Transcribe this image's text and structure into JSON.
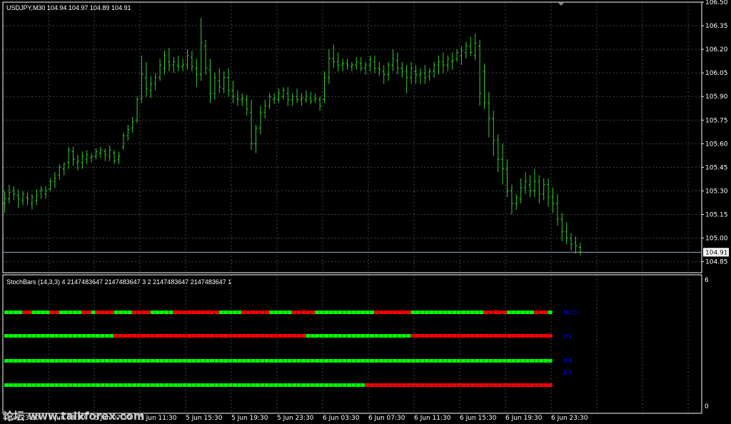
{
  "colors": {
    "background": "#000000",
    "grid": "#3a4a4a",
    "frame": "#ffffff",
    "bar": "#32cd32",
    "last_price_line": "#8eaec8",
    "stoch_up": "#00ff00",
    "stoch_down": "#ff0000",
    "tf_label": "#0000ff"
  },
  "chart_data": [
    {
      "type": "ohlc",
      "title": "USDJPY,M30  104.94 104.97 104.89 104.91",
      "symbol": "USDJPY,M30",
      "y_ticks": [
        "106.50",
        "106.35",
        "106.20",
        "106.05",
        "105.90",
        "105.75",
        "105.60",
        "105.45",
        "105.30",
        "105.15",
        "105.00",
        "104.85"
      ],
      "ylim": [
        104.78,
        106.5
      ],
      "last_price": "104.91",
      "x_ticks": [
        "4 Jun 23:30",
        "5 Jun 03:30",
        "5 Jun 07:30",
        "5 Jun 11:30",
        "5 Jun 15:30",
        "5 Jun 19:30",
        "5 Jun 23:30",
        "6 Jun 03:30",
        "6 Jun 07:30",
        "6 Jun 11:30",
        "6 Jun 15:30",
        "6 Jun 19:30",
        "6 Jun 23:30"
      ],
      "bars": [
        [
          105.22,
          105.3,
          105.16,
          105.25
        ],
        [
          105.25,
          105.34,
          105.22,
          105.29
        ],
        [
          105.3,
          105.33,
          105.24,
          105.28
        ],
        [
          105.27,
          105.31,
          105.19,
          105.25
        ],
        [
          105.24,
          105.3,
          105.21,
          105.28
        ],
        [
          105.26,
          105.29,
          105.21,
          105.25
        ],
        [
          105.22,
          105.28,
          105.18,
          105.26
        ],
        [
          105.24,
          105.31,
          105.21,
          105.27
        ],
        [
          105.3,
          105.33,
          105.25,
          105.31
        ],
        [
          105.28,
          105.33,
          105.25,
          105.3
        ],
        [
          105.31,
          105.38,
          105.3,
          105.36
        ],
        [
          105.36,
          105.42,
          105.32,
          105.38
        ],
        [
          105.4,
          105.47,
          105.37,
          105.45
        ],
        [
          105.44,
          105.48,
          105.4,
          105.47
        ],
        [
          105.48,
          105.58,
          105.44,
          105.56
        ],
        [
          105.55,
          105.58,
          105.46,
          105.5
        ],
        [
          105.48,
          105.53,
          105.43,
          105.49
        ],
        [
          105.48,
          105.55,
          105.44,
          105.52
        ],
        [
          105.5,
          105.56,
          105.47,
          105.53
        ],
        [
          105.51,
          105.54,
          105.48,
          105.52
        ],
        [
          105.52,
          105.57,
          105.5,
          105.55
        ],
        [
          105.54,
          105.58,
          105.51,
          105.56
        ],
        [
          105.55,
          105.57,
          105.49,
          105.53
        ],
        [
          105.52,
          105.59,
          105.49,
          105.56
        ],
        [
          105.54,
          105.56,
          105.47,
          105.49
        ],
        [
          105.5,
          105.55,
          105.47,
          105.52
        ],
        [
          105.58,
          105.67,
          105.56,
          105.65
        ],
        [
          105.65,
          105.72,
          105.62,
          105.69
        ],
        [
          105.7,
          105.77,
          105.67,
          105.74
        ],
        [
          105.75,
          105.9,
          105.73,
          105.88
        ],
        [
          105.89,
          106.16,
          105.86,
          106.04
        ],
        [
          106.02,
          106.12,
          105.9,
          105.95
        ],
        [
          105.94,
          106.03,
          105.89,
          105.98
        ],
        [
          105.98,
          106.05,
          105.94,
          106.02
        ],
        [
          106.02,
          106.14,
          106.0,
          106.1
        ],
        [
          106.08,
          106.19,
          106.04,
          106.16
        ],
        [
          106.12,
          106.21,
          106.06,
          106.1
        ],
        [
          106.1,
          106.15,
          106.05,
          106.12
        ],
        [
          106.1,
          106.16,
          106.06,
          106.09
        ],
        [
          106.09,
          106.14,
          106.06,
          106.1
        ],
        [
          106.1,
          106.2,
          106.07,
          106.16
        ],
        [
          106.15,
          106.19,
          106.06,
          106.09
        ],
        [
          106.08,
          106.14,
          105.96,
          106.04
        ],
        [
          106.04,
          106.4,
          106.0,
          106.24
        ],
        [
          106.22,
          106.26,
          106.04,
          106.08
        ],
        [
          106.07,
          106.14,
          105.86,
          105.92
        ],
        [
          105.92,
          106.05,
          105.88,
          106.02
        ],
        [
          106.0,
          106.08,
          105.92,
          105.96
        ],
        [
          105.95,
          106.06,
          105.92,
          106.02
        ],
        [
          106.02,
          106.08,
          105.9,
          105.94
        ],
        [
          105.94,
          106.0,
          105.86,
          105.9
        ],
        [
          105.89,
          105.94,
          105.84,
          105.88
        ],
        [
          105.88,
          105.92,
          105.84,
          105.89
        ],
        [
          105.88,
          105.91,
          105.78,
          105.82
        ],
        [
          105.8,
          105.88,
          105.56,
          105.6
        ],
        [
          105.6,
          105.72,
          105.54,
          105.7
        ],
        [
          105.7,
          105.84,
          105.66,
          105.8
        ],
        [
          105.8,
          105.88,
          105.76,
          105.84
        ],
        [
          105.84,
          105.92,
          105.82,
          105.9
        ],
        [
          105.88,
          105.92,
          105.85,
          105.89
        ],
        [
          105.88,
          105.95,
          105.86,
          105.92
        ],
        [
          105.9,
          105.96,
          105.88,
          105.94
        ],
        [
          105.92,
          105.96,
          105.84,
          105.88
        ],
        [
          105.88,
          105.92,
          105.84,
          105.9
        ],
        [
          105.9,
          105.95,
          105.86,
          105.88
        ],
        [
          105.88,
          105.92,
          105.84,
          105.89
        ],
        [
          105.88,
          105.94,
          105.86,
          105.9
        ],
        [
          105.89,
          105.93,
          105.85,
          105.87
        ],
        [
          105.88,
          105.92,
          105.86,
          105.89
        ],
        [
          105.88,
          105.9,
          105.81,
          105.84
        ],
        [
          105.88,
          106.06,
          105.86,
          106.02
        ],
        [
          106.02,
          106.2,
          105.98,
          106.14
        ],
        [
          106.14,
          106.23,
          106.08,
          106.12
        ],
        [
          106.12,
          106.18,
          106.06,
          106.1
        ],
        [
          106.1,
          106.14,
          106.06,
          106.11
        ],
        [
          106.11,
          106.14,
          106.07,
          106.1
        ],
        [
          106.09,
          106.12,
          106.06,
          106.1
        ],
        [
          106.1,
          106.15,
          106.07,
          106.12
        ],
        [
          106.11,
          106.15,
          106.06,
          106.08
        ],
        [
          106.08,
          106.12,
          106.04,
          106.1
        ],
        [
          106.1,
          106.16,
          106.06,
          106.14
        ],
        [
          106.12,
          106.16,
          106.05,
          106.08
        ],
        [
          106.08,
          106.12,
          106.03,
          106.07
        ],
        [
          106.06,
          106.1,
          105.98,
          106.04
        ],
        [
          106.04,
          106.12,
          106.0,
          106.1
        ],
        [
          106.1,
          106.2,
          106.06,
          106.14
        ],
        [
          106.13,
          106.18,
          106.04,
          106.08
        ],
        [
          106.08,
          106.12,
          106.02,
          106.06
        ],
        [
          106.06,
          106.1,
          105.92,
          106.02
        ],
        [
          106.02,
          106.12,
          105.98,
          106.08
        ],
        [
          106.06,
          106.1,
          105.98,
          106.04
        ],
        [
          106.04,
          106.08,
          105.98,
          106.05
        ],
        [
          106.05,
          106.1,
          105.98,
          106.02
        ],
        [
          106.03,
          106.08,
          106.0,
          106.06
        ],
        [
          106.06,
          106.12,
          106.02,
          106.1
        ],
        [
          106.1,
          106.16,
          106.04,
          106.12
        ],
        [
          106.12,
          106.18,
          106.05,
          106.1
        ],
        [
          106.1,
          106.16,
          106.06,
          106.14
        ],
        [
          106.12,
          106.18,
          106.07,
          106.13
        ],
        [
          106.14,
          106.2,
          106.12,
          106.18
        ],
        [
          106.16,
          106.22,
          106.1,
          106.19
        ],
        [
          106.18,
          106.25,
          106.14,
          106.22
        ],
        [
          106.22,
          106.28,
          106.16,
          106.18
        ],
        [
          106.16,
          106.3,
          106.13,
          106.24
        ],
        [
          106.22,
          106.26,
          105.84,
          105.92
        ],
        [
          106.06,
          106.11,
          105.82,
          105.86
        ],
        [
          105.86,
          105.93,
          105.64,
          105.76
        ],
        [
          105.76,
          105.81,
          105.52,
          105.62
        ],
        [
          105.62,
          105.66,
          105.42,
          105.5
        ],
        [
          105.5,
          105.6,
          105.34,
          105.44
        ],
        [
          105.44,
          105.5,
          105.26,
          105.3
        ],
        [
          105.3,
          105.34,
          105.15,
          105.22
        ],
        [
          105.22,
          105.28,
          105.18,
          105.26
        ],
        [
          105.25,
          105.38,
          105.22,
          105.32
        ],
        [
          105.32,
          105.42,
          105.28,
          105.36
        ],
        [
          105.34,
          105.4,
          105.26,
          105.3
        ],
        [
          105.3,
          105.44,
          105.26,
          105.36
        ],
        [
          105.36,
          105.4,
          105.22,
          105.28
        ],
        [
          105.28,
          105.38,
          105.24,
          105.34
        ],
        [
          105.34,
          105.38,
          105.2,
          105.26
        ],
        [
          105.26,
          105.32,
          105.16,
          105.22
        ],
        [
          105.22,
          105.28,
          105.08,
          105.12
        ],
        [
          105.12,
          105.16,
          104.98,
          105.04
        ],
        [
          105.04,
          105.1,
          104.96,
          105.0
        ],
        [
          105.0,
          105.03,
          104.92,
          104.96
        ],
        [
          104.97,
          105.01,
          104.9,
          104.95
        ],
        [
          104.94,
          104.97,
          104.89,
          104.91
        ]
      ]
    },
    {
      "type": "indicator-dots",
      "title": "StochBars (14,3,3) 4 2147483647 2147483647 3 2 2147483647 2147483647 1",
      "scale_max": "6",
      "scale_min": "0",
      "rows": [
        {
          "name": "M30",
          "pattern": "GGGGRRGGGGRRGGGGGRRGRRRRGGGGRRRRGGGGGRRRRRRRRRRGGGGGRRRRRRGGGGGRRRRRGGGGGGGGGGGGGRRRRRRRRGGGGGGGGGGGGGGGGRRRRRGGGGGGRRRGGGRRRRRGG"
        },
        {
          "name": "H1",
          "pattern": "GGGGGGGGGGGGGGGGGGGGGGGGRRRRRRRRRRRRRRRRRRRRRRRRRRRRRRRRRRRRRRRRRRGGGGGGGGGGGGGGGGGGGGGGGRRRRRRRRRRRRRRRRRRRRRRRRRRRRRRRRRRRRRRRRR"
        },
        {
          "name": "H4",
          "pattern": "GGGGGGGGGGGGGGGGGGGGGGGGGGGGGGGGGGGGGGGGGGGGGGGGGGGGGGGGGGGGGGGGGGGGGGGGGGGGGGGGGGGGGGGGGGGGGGGGGGGGGGGGGGGGGGGGGGGGGGGGGGGGGGGG"
        },
        {
          "name": "D1",
          "pattern": "GGGGGGGGGGGGGGGGGGGGGGGGGGGGGGGGGGGGGGGGGGGGGGGGGGGGGGGGGGGGGGGGGGGGGGGGGGGGGGGRRRRRRRRRRRRRRRRRRRRRRRRRRRRRRRRRRRRRRRRRRRRRRRRRRR"
        }
      ]
    }
  ],
  "watermark": "论坛  www.talkforex.com"
}
